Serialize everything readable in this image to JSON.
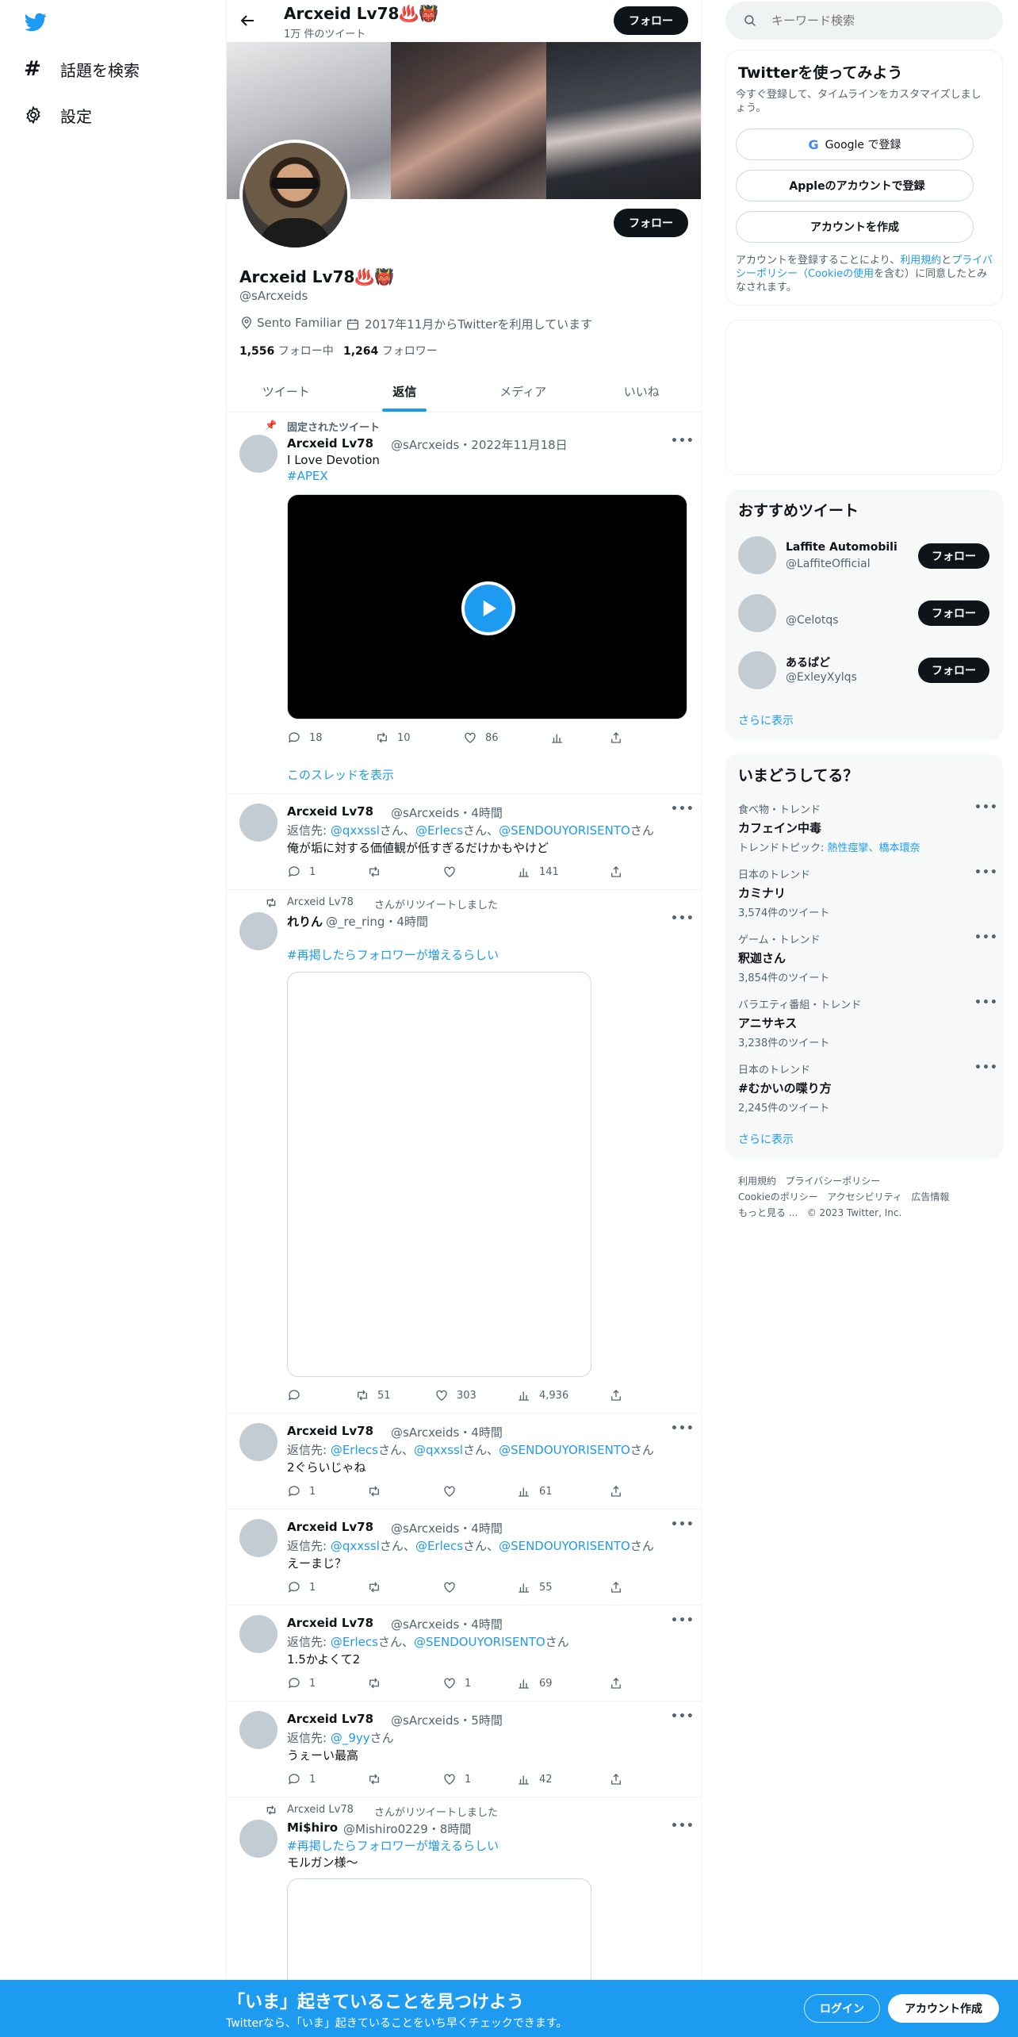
{
  "nav": {
    "explore": "話題を検索",
    "settings": "設定"
  },
  "header": {
    "name": "Arcxeid Lv78♨️👹",
    "tweet_count": "1万 件のツイート",
    "follow": "フォロー"
  },
  "profile": {
    "display_name": "Arcxeid Lv78♨️👹",
    "handle": "@sArcxeids",
    "location": "Sento Familiar",
    "joined": "2017年11月からTwitterを利用しています",
    "following_count": "1,556",
    "following_label": "フォロー中",
    "followers_count": "1,264",
    "followers_label": "フォロワー",
    "follow": "フォロー"
  },
  "tabs": [
    {
      "label": "ツイート"
    },
    {
      "label": "返信"
    },
    {
      "label": "メディア"
    },
    {
      "label": "いいね"
    }
  ],
  "tweets": [
    {
      "pinned": "固定されたツイート",
      "name": "Arcxeid Lv78",
      "meta": "@sArcxeids・2022年11月18日",
      "text": "I Love Devotion",
      "hashtag": "#APEX",
      "replies": "18",
      "retweets": "10",
      "likes": "86",
      "thread_link": "このスレッドを表示"
    },
    {
      "name": "Arcxeid Lv78",
      "meta": "@sArcxeids・4時間",
      "reply_prefix": "返信先: ",
      "reply_links": [
        "@qxxssl",
        "@Erlecs",
        "@SENDOUYORISENTO"
      ],
      "san": "さん",
      "sep": "、",
      "text": "俺が垢に対する価値観が低すぎるだけかもやけど",
      "replies": "1",
      "views": "141"
    },
    {
      "retweeted_by": "Arcxeid Lv78",
      "retweet_label": "さんがリツイートしました",
      "name": "れりん",
      "meta": "@_re_ring・4時間",
      "hashtag": "#再掲したらフォロワーが増えるらしい",
      "retweets": "51",
      "likes": "303",
      "views": "4,936"
    },
    {
      "name": "Arcxeid Lv78",
      "meta": "@sArcxeids・4時間",
      "reply_prefix": "返信先: ",
      "reply_links": [
        "@Erlecs",
        "@qxxssl",
        "@SENDOUYORISENTO"
      ],
      "text": "2ぐらいじゃね",
      "replies": "1",
      "views": "61"
    },
    {
      "name": "Arcxeid Lv78",
      "meta": "@sArcxeids・4時間",
      "reply_prefix": "返信先: ",
      "reply_links": [
        "@qxxssl",
        "@Erlecs",
        "@SENDOUYORISENTO"
      ],
      "text": "えーまじ？",
      "replies": "1",
      "views": "55"
    },
    {
      "name": "Arcxeid Lv78",
      "meta": "@sArcxeids・4時間",
      "reply_prefix": "返信先: ",
      "reply_links": [
        "@Erlecs",
        "@SENDOUYORISENTO"
      ],
      "text": "1.5かよくて2",
      "replies": "1",
      "likes": "1",
      "views": "69"
    },
    {
      "name": "Arcxeid Lv78",
      "meta": "@sArcxeids・5時間",
      "reply_prefix": "返信先: ",
      "reply_links": [
        "@_9yy"
      ],
      "text": "うぇーい最高",
      "replies": "1",
      "likes": "1",
      "views": "42"
    },
    {
      "retweeted_by": "Arcxeid Lv78",
      "retweet_label": "さんがリツイートしました",
      "name": "Mi$hiro",
      "meta": "@Mishiro0229・8時間",
      "hashtag": "#再掲したらフォロワーが増えるらしい",
      "text": "モルガン様～"
    }
  ],
  "search": {
    "placeholder": "キーワード検索"
  },
  "signup": {
    "title": "Twitterを使ってみよう",
    "subtitle": "今すぐ登録して、タイムラインをカスタマイズしましょう。",
    "google": "Google で登録",
    "apple": "Appleのアカウントで登録",
    "create": "アカウントを作成",
    "legal_1": "アカウントを登録することにより、",
    "terms": "利用規約",
    "and": "と",
    "privacy": "プライバシーポリシー（Cookieの使用",
    "legal_2": "を含む）に同意したとみなされます。"
  },
  "recommend": {
    "title": "おすすめツイート",
    "users": [
      {
        "name": "Laffite Automobili",
        "handle": "@LaffiteOfficial"
      },
      {
        "name": "",
        "handle": "@Celotqs"
      },
      {
        "name": "あるぱど",
        "handle": "@ExleyXylqs"
      }
    ],
    "follow": "フォロー",
    "more": "さらに表示"
  },
  "trends": {
    "title": "いまどうしてる？",
    "items": [
      {
        "category": "食べ物・トレンド",
        "title": "カフェイン中毒",
        "sub_prefix": "トレンドトピック: ",
        "sub_links": "熱性痙攣、橋本環奈"
      },
      {
        "category": "日本のトレンド",
        "title": "カミナリ",
        "count": "3,574件のツイート"
      },
      {
        "category": "ゲーム・トレンド",
        "title": "釈迦さん",
        "count": "3,854件のツイート"
      },
      {
        "category": "バラエティ番組・トレンド",
        "title": "アニサキス",
        "count": "3,238件のツイート"
      },
      {
        "category": "日本のトレンド",
        "title": "#むかいの喋り方",
        "count": "2,245件のツイート"
      }
    ],
    "more": "さらに表示"
  },
  "footer": {
    "links": [
      "利用規約",
      "プライバシーポリシー",
      "Cookieのポリシー",
      "アクセシビリティ",
      "広告情報",
      "もっと見る ..."
    ],
    "copyright": "© 2023 Twitter, Inc."
  },
  "banner": {
    "title": "「いま」起きていることを見つけよう",
    "subtitle": "Twitterなら、「いま」起きていることをいち早くチェックできます。",
    "login": "ログイン",
    "signup": "アカウント作成"
  },
  "colors": {
    "accent": "#1d9bf0",
    "banner": "#1d9bf0",
    "text": "#0f1419",
    "muted": "#536471"
  }
}
